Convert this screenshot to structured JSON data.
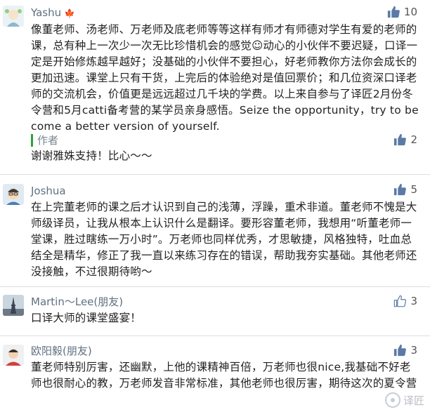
{
  "comments": [
    {
      "user": "Yashu",
      "user_icon": "maple-leaf-icon",
      "likes": "10",
      "liked": true,
      "text": "像董老师、汤老师、万老师及底老师等等这样有师才有师德对学生有爱的老师的课，总有种上一次少一次无比珍惜机会的感觉☺动心的小伙伴不要迟疑，口译一定是开始修炼越早越好；没基础的小伙伴不要担心，好老师教你方法你会成长的更加迅速。课堂上只有干货，上完后的体验绝对是值回票价；和几位资深口译老师的交流机会，价值更是远远超过几千块的学费。以上来自参与了译匠2月份冬令营和5月catti备考营的某学员亲身感悟。Seize the opportunity，try to become a better version of yourself.",
      "reply": {
        "label": "作者",
        "likes": "2",
        "text": "谢谢雅姝支持！比心～～"
      }
    },
    {
      "user": "Joshua",
      "likes": "5",
      "liked": true,
      "text": "在上完董老师的课之后才认识到自己的浅薄，浮躁，重术非道。董老师不愧是大师级译员，让我从根本上认识什么是翻译。要形容董老师，我想用“听董老师一堂课，胜过瞎练一万小时”。万老师也同样优秀，才思敏捷，风格独特，吐血总结全是精华，修正了我一直以来练习存在的错误，帮助我夯实基础。其他老师还没接触，不过很期待哟～"
    },
    {
      "user": "Martin～Lee(朋友)",
      "likes": "3",
      "liked": false,
      "text": "口译大师的课堂盛宴！"
    },
    {
      "user": "欧阳毅(朋友)",
      "likes": "3",
      "liked": true,
      "text": "董老师特别厉害，还幽默，上他的课精神百倍，万老师也很nice,我基础不好老师也很耐心的教，万老师发音非常标准，其他老师也很厉害，期待这次的夏令营"
    }
  ],
  "watermark": "译匠",
  "colors": {
    "name": "#607080",
    "like_filled": "#5b7aa6",
    "author_bar": "#2aa339"
  }
}
